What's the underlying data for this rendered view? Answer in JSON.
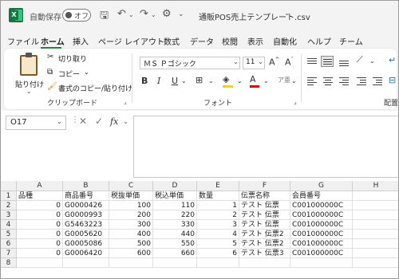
{
  "titlebar": {
    "autosave_label": "自動保存",
    "autosave_state": "オフ",
    "filename": "通販POS売上テンプレート.csv",
    "chevron": "⌄"
  },
  "menu": {
    "tabs": [
      "ファイル",
      "ホーム",
      "挿入",
      "ページ レイアウト",
      "数式",
      "データ",
      "校閲",
      "表示",
      "自動化",
      "ヘルプ",
      "チーム"
    ],
    "active": "ホーム"
  },
  "ribbon": {
    "clipboard": {
      "paste": "貼り付け",
      "cut": "切り取り",
      "copy": "コピー",
      "format_painter": "書式のコピー/貼り付け",
      "group": "クリップボード"
    },
    "font": {
      "font_name": "ＭＳ Ｐゴシック",
      "font_size": "11",
      "bold": "B",
      "italic": "I",
      "underline": "U",
      "group": "フォント"
    },
    "alignment": {
      "group": "配置"
    }
  },
  "formula_bar": {
    "name_box": "O17",
    "fx": "fx",
    "formula": ""
  },
  "sheet": {
    "columns": [
      "A",
      "B",
      "C",
      "D",
      "E",
      "F",
      "G",
      "H"
    ],
    "rows": [
      "1",
      "2",
      "3",
      "4",
      "5",
      "6",
      "7",
      "8"
    ],
    "headers": [
      "品種",
      "商品番号",
      "税抜単価",
      "税込単価",
      "数量",
      "伝票名称",
      "会員番号",
      ""
    ],
    "data": [
      [
        "0",
        "G0000426",
        "100",
        "110",
        "1",
        "テスト 伝票",
        "C001000000C",
        ""
      ],
      [
        "0",
        "G0000993",
        "200",
        "220",
        "2",
        "テスト 伝票",
        "C001000000C",
        ""
      ],
      [
        "0",
        "G5463223",
        "300",
        "330",
        "3",
        "テスト 伝票",
        "C001000000C",
        ""
      ],
      [
        "0",
        "G0005620",
        "400",
        "440",
        "4",
        "テスト 伝票2",
        "C001000000C",
        ""
      ],
      [
        "0",
        "G0005086",
        "500",
        "550",
        "5",
        "テスト 伝票2",
        "C001000000C",
        ""
      ],
      [
        "0",
        "G0006420",
        "600",
        "660",
        "6",
        "テスト 伝票3",
        "C001000000C",
        ""
      ]
    ]
  }
}
